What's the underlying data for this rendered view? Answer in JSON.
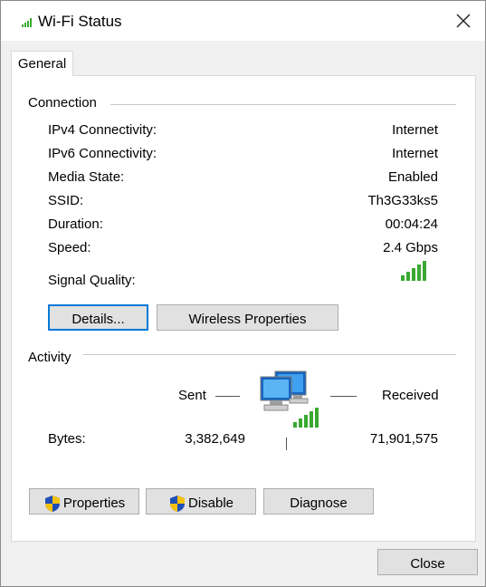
{
  "window": {
    "title": "Wi-Fi Status"
  },
  "tabs": [
    {
      "label": "General"
    }
  ],
  "connection": {
    "heading": "Connection",
    "rows": [
      {
        "label": "IPv4 Connectivity:",
        "value": "Internet"
      },
      {
        "label": "IPv6 Connectivity:",
        "value": "Internet"
      },
      {
        "label": "Media State:",
        "value": "Enabled"
      },
      {
        "label": "SSID:",
        "value": "Th3G33ks5"
      },
      {
        "label": "Duration:",
        "value": "00:04:24"
      },
      {
        "label": "Speed:",
        "value": "2.4 Gbps"
      }
    ],
    "signal_label": "Signal Quality:",
    "signal_bars": 5,
    "details_button": "Details...",
    "wireless_button": "Wireless Properties"
  },
  "activity": {
    "heading": "Activity",
    "sent_label": "Sent",
    "received_label": "Received",
    "bytes_label": "Bytes:",
    "bytes_sent": "3,382,649",
    "bytes_received": "71,901,575"
  },
  "buttons": {
    "properties": "Properties",
    "disable": "Disable",
    "diagnose": "Diagnose",
    "close": "Close"
  },
  "colors": {
    "signal_green": "#3aa832",
    "accent": "#0078d7"
  }
}
